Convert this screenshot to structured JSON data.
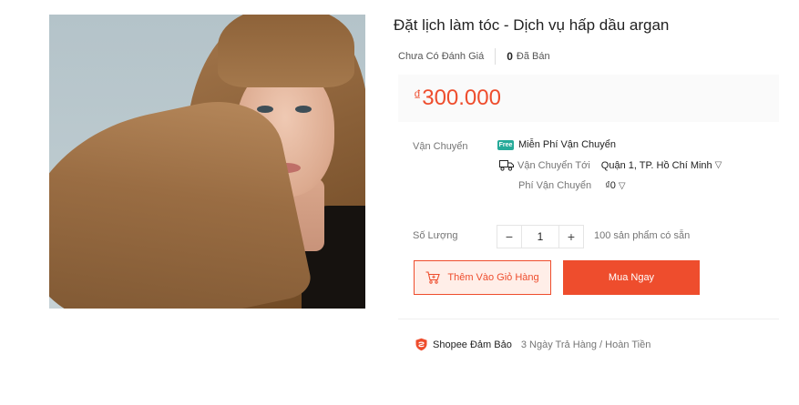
{
  "product": {
    "title": "Đặt lịch làm tóc - Dịch vụ hấp dầu argan",
    "rating_text": "Chưa Có Đánh Giá",
    "sold_count": "0",
    "sold_label": "Đã Bán",
    "currency_symbol": "₫",
    "price": "300.000"
  },
  "shipping": {
    "label": "Vận Chuyển",
    "free_text": "Miễn Phí Vận Chuyển",
    "free_icon_text": "Free",
    "ship_to_label": "Vận Chuyển Tới",
    "ship_to_location": "Quận 1, TP. Hồ Chí Minh",
    "fee_label": "Phí Vận Chuyển",
    "fee_value": "₫0"
  },
  "quantity": {
    "label": "Số Lượng",
    "minus": "−",
    "value": "1",
    "plus": "+",
    "stock_text": "100 sản phẩm có sẵn"
  },
  "actions": {
    "add_to_cart": "Thêm Vào Giỏ Hàng",
    "buy_now": "Mua Ngay"
  },
  "guarantee": {
    "name": "Shopee Đảm Bảo",
    "description": "3 Ngày Trả Hàng / Hoàn Tiền"
  },
  "colors": {
    "accent": "#ee4d2d",
    "free_shipping": "#26aa99"
  },
  "icons": [
    "chevron-down-icon",
    "truck-icon",
    "free-shipping-icon",
    "cart-icon",
    "shield-icon"
  ]
}
